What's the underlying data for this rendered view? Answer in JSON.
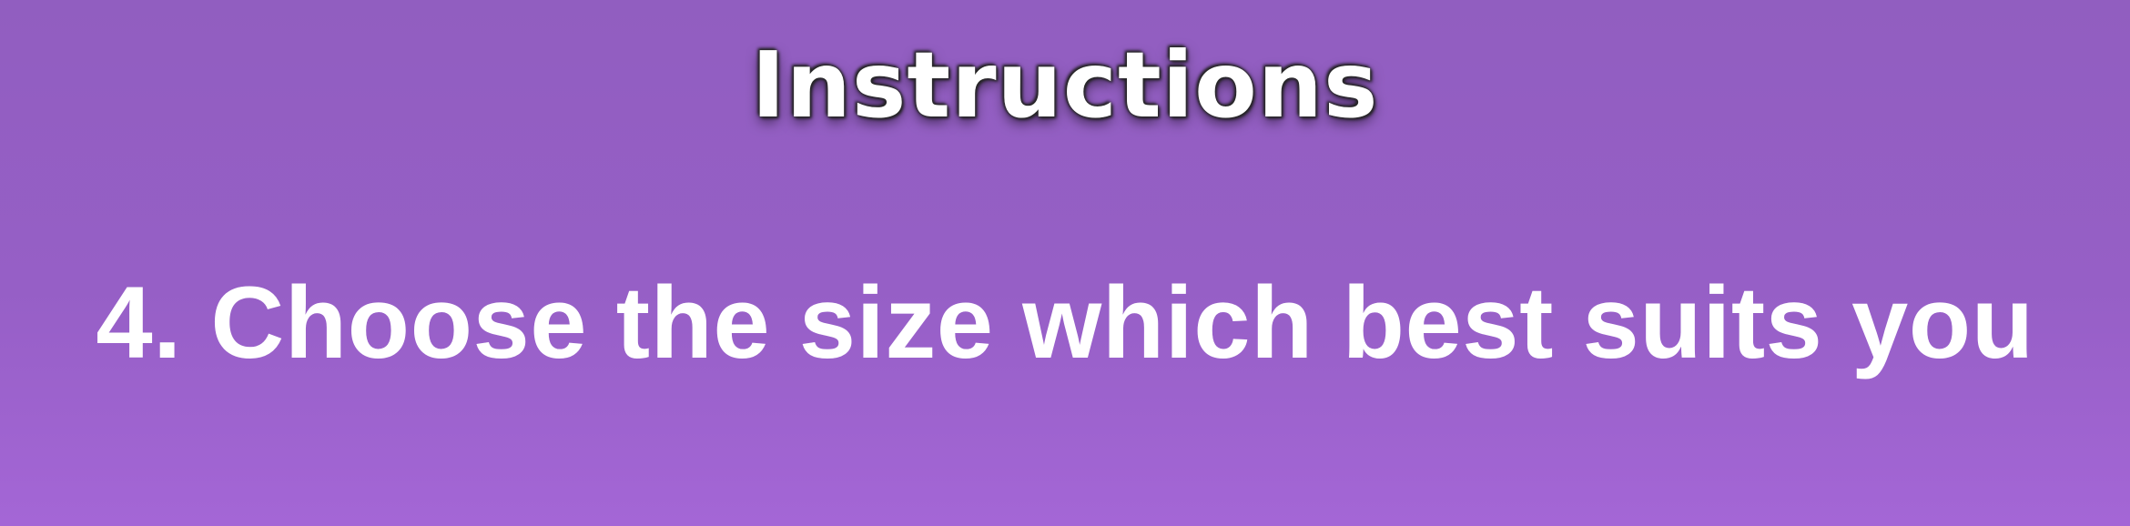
{
  "screen": {
    "title": "Instructions",
    "step_text": "4. Choose the size which best suits you"
  },
  "colors": {
    "background_top": "#915ec0",
    "background_bottom": "#a466d6",
    "text": "#ffffff"
  }
}
